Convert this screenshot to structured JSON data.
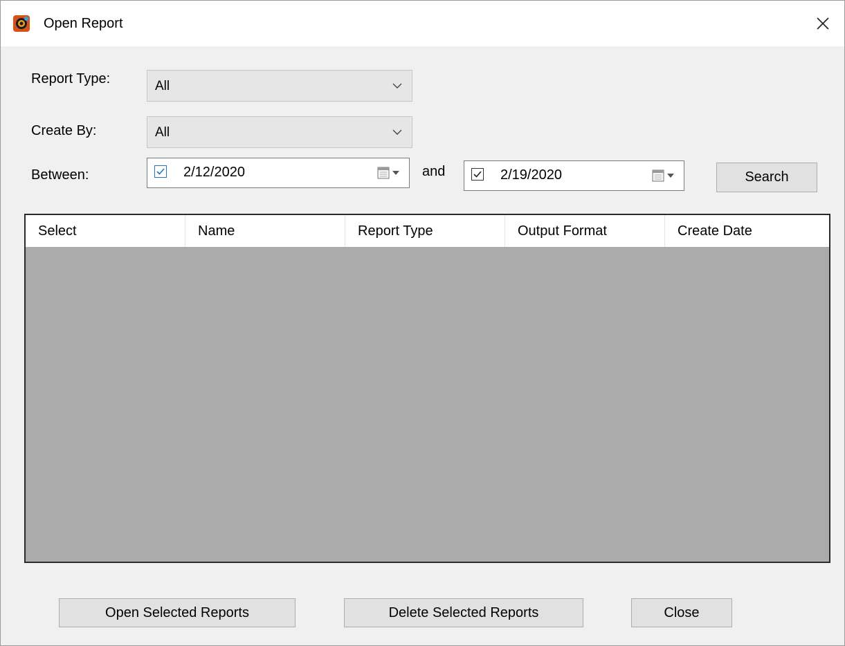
{
  "window": {
    "title": "Open Report"
  },
  "filters": {
    "report_type": {
      "label": "Report Type:",
      "value": "All"
    },
    "create_by": {
      "label": "Create By:",
      "value": "All"
    },
    "between": {
      "label": "Between:",
      "from": {
        "checked": true,
        "value": "2/12/2020"
      },
      "and_label": "and",
      "to": {
        "checked": true,
        "value": "2/19/2020"
      }
    },
    "search_label": "Search"
  },
  "table": {
    "columns": [
      "Select",
      "Name",
      "Report Type",
      "Output Format",
      "Create Date"
    ],
    "rows": []
  },
  "actions": {
    "open_label": "Open Selected Reports",
    "delete_label": "Delete Selected Reports",
    "close_label": "Close"
  },
  "colors": {
    "table_body": "#ababab",
    "button_face": "#e1e1e1",
    "checkbox_accent": "#1e73c8"
  },
  "icons": [
    "app-icon",
    "close-icon",
    "chevron-down-icon",
    "calendar-icon",
    "checkbox-checked-icon"
  ]
}
